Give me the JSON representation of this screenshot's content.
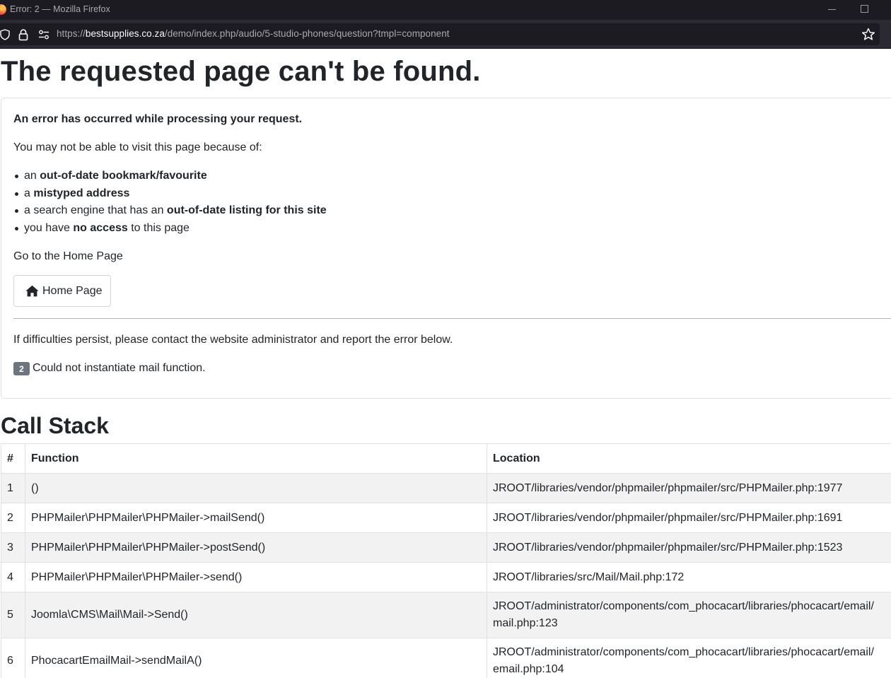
{
  "window": {
    "title": "Error: 2 — Mozilla Firefox"
  },
  "urlbar": {
    "url_prefix": "https://",
    "url_host": "bestsupplies.co.za",
    "url_path": "/demo/index.php/audio/5-studio-phones/question?tmpl=component"
  },
  "page": {
    "title": "The requested page can't be found.",
    "error_heading": "An error has occurred while processing your request.",
    "reasons_intro": "You may not be able to visit this page because of:",
    "reasons": [
      {
        "pre": "an ",
        "strong": "out-of-date bookmark/favourite",
        "post": ""
      },
      {
        "pre": "a ",
        "strong": "mistyped address",
        "post": ""
      },
      {
        "pre": "a search engine that has an ",
        "strong": "out-of-date listing for this site",
        "post": ""
      },
      {
        "pre": "you have ",
        "strong": "no access",
        "post": " to this page"
      }
    ],
    "home_prompt": "Go to the Home Page",
    "home_button_label": "Home Page",
    "persist_note": "If difficulties persist, please contact the website administrator and report the error below.",
    "error_code": "2",
    "error_message": "Could not instantiate mail function."
  },
  "call_stack": {
    "title": "Call Stack",
    "headers": [
      "#",
      "Function",
      "Location"
    ],
    "rows": [
      {
        "num": "1",
        "function": "()",
        "location_lines": [
          "JROOT/libraries/vendor/phpmailer/phpmailer/src/PHPMailer.php:1977"
        ]
      },
      {
        "num": "2",
        "function": "PHPMailer\\PHPMailer\\PHPMailer->mailSend()",
        "location_lines": [
          "JROOT/libraries/vendor/phpmailer/phpmailer/src/PHPMailer.php:1691"
        ]
      },
      {
        "num": "3",
        "function": "PHPMailer\\PHPMailer\\PHPMailer->postSend()",
        "location_lines": [
          "JROOT/libraries/vendor/phpmailer/phpmailer/src/PHPMailer.php:1523"
        ]
      },
      {
        "num": "4",
        "function": "PHPMailer\\PHPMailer\\PHPMailer->send()",
        "location_lines": [
          "JROOT/libraries/src/Mail/Mail.php:172"
        ]
      },
      {
        "num": "5",
        "function": "Joomla\\CMS\\Mail\\Mail->Send()",
        "location_lines": [
          "JROOT/administrator/components/com_phocacart/libraries/phocacart/email/",
          "mail.php:123"
        ]
      },
      {
        "num": "6",
        "function": "PhocacartEmailMail->sendMailA()",
        "location_lines": [
          "JROOT/administrator/components/com_phocacart/libraries/phocacart/email/",
          "email.php:104"
        ]
      }
    ]
  },
  "icons": {
    "browser_logo": "firefox-logo-icon",
    "minimize": "minimize-icon",
    "maximize": "maximize-icon",
    "tracking": "shield-icon",
    "security": "lock-icon",
    "permissions": "permissions-icon",
    "bookmark": "star-icon",
    "home": "house-icon"
  },
  "colors": {
    "titlebar_bg": "#1c1b22",
    "toolbar_bg": "#2b2a33",
    "text": "#212529",
    "border": "#dee2e6",
    "badge_bg": "#6c757d",
    "row_stripe": "#f2f2f2"
  }
}
